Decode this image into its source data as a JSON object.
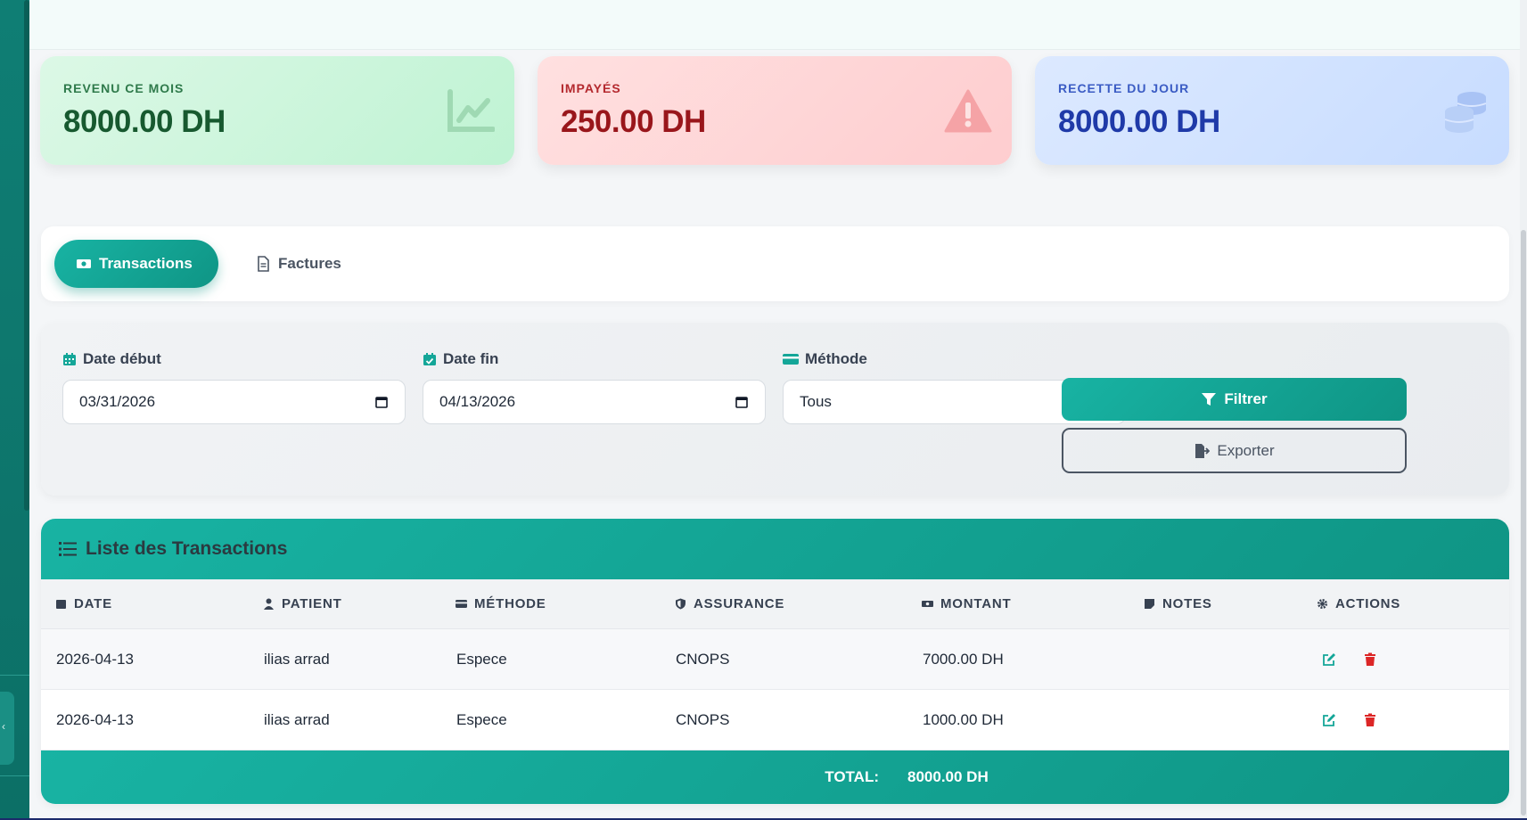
{
  "stats": {
    "revenue_label": "REVENU CE MOIS",
    "revenue_value": "8000.00 DH",
    "unpaid_label": "IMPAYÉS",
    "unpaid_value": "250.00 DH",
    "daily_label": "RECETTE DU JOUR",
    "daily_value": "8000.00 DH"
  },
  "tabs": {
    "transactions": "Transactions",
    "factures": "Factures"
  },
  "filters": {
    "date_start_label": "Date début",
    "date_start_value": "03/31/2026",
    "date_end_label": "Date fin",
    "date_end_value": "04/13/2026",
    "method_label": "Méthode",
    "method_value": "Tous",
    "filter_button": "Filtrer",
    "export_button": "Exporter"
  },
  "list": {
    "title": "Liste des Transactions",
    "columns": [
      "DATE",
      "PATIENT",
      "MÉTHODE",
      "ASSURANCE",
      "MONTANT",
      "NOTES",
      "ACTIONS"
    ],
    "rows": [
      {
        "date": "2026-04-13",
        "patient": "ilias arrad",
        "method": "Espece",
        "insurance": "CNOPS",
        "amount": "7000.00 DH",
        "notes": ""
      },
      {
        "date": "2026-04-13",
        "patient": "ilias arrad",
        "method": "Espece",
        "insurance": "CNOPS",
        "amount": "1000.00 DH",
        "notes": ""
      }
    ],
    "total_label": "TOTAL:",
    "total_value": "8000.00 DH"
  },
  "colors": {
    "accent": "#14a698",
    "sidebar": "#0f7e74",
    "danger": "#dc2626"
  }
}
